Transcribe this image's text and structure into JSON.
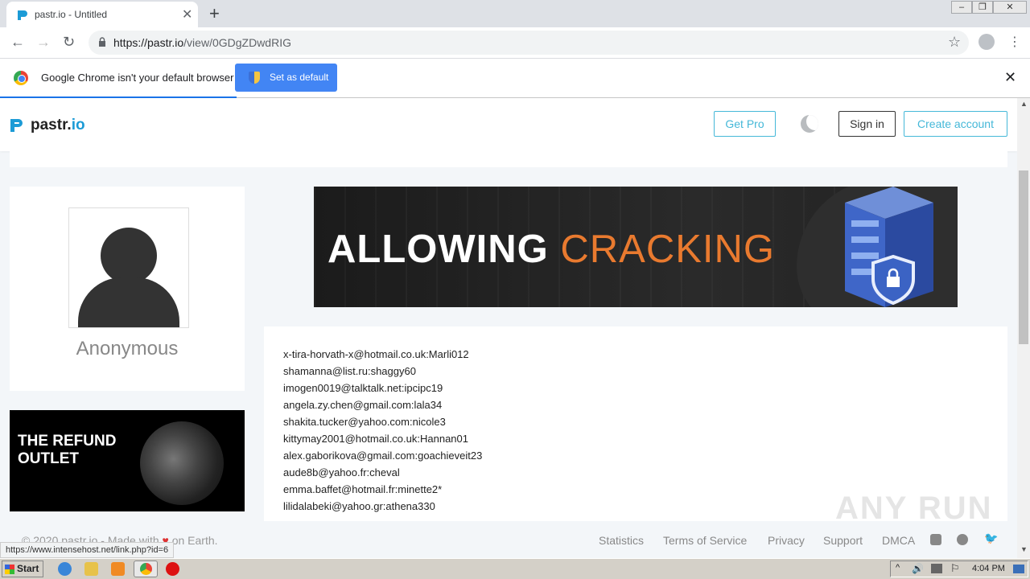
{
  "browser": {
    "tab_title": "pastr.io - Untitled",
    "url_host": "https://pastr.io",
    "url_path": "/view/0GDgZDwdRIG",
    "infobar_text": "Google Chrome isn't your default browser",
    "set_default_label": "Set as default"
  },
  "header": {
    "logo_text": "pastr.",
    "logo_suffix": "io",
    "get_pro_label": "Get Pro",
    "signin_label": "Sign in",
    "create_account_label": "Create account"
  },
  "profile": {
    "name": "Anonymous"
  },
  "ads": {
    "banner_word1": "ALLOWING",
    "banner_word2": "CRACKING",
    "refund_line1": "THE REFUND",
    "refund_line2": "OUTLET"
  },
  "paste": {
    "lines": [
      "x-tira-horvath-x@hotmail.co.uk:Marli012",
      "shamanna@list.ru:shaggy60",
      "imogen0019@talktalk.net:ipcipc19",
      "angela.zy.chen@gmail.com:lala34",
      "shakita.tucker@yahoo.com:nicole3",
      "kittymay2001@hotmail.co.uk:Hannan01",
      "alex.gaborikova@gmail.com:goachieveit23",
      "aude8b@yahoo.fr:cheval",
      "emma.baffet@hotmail.fr:minette2*",
      "lilidalabeki@yahoo.gr:athena330"
    ]
  },
  "footer": {
    "copyright_pre": "© 2020 pastr.io - Made with",
    "copyright_post": "on Earth.",
    "links": [
      "Statistics",
      "Terms of Service",
      "Privacy",
      "Support",
      "DMCA"
    ]
  },
  "status_url": "https://www.intensehost.net/link.php?id=6",
  "watermark": "ANY RUN",
  "taskbar": {
    "start_label": "Start",
    "clock": "4:04 PM"
  },
  "colors": {
    "accent": "#45b8d8",
    "brand": "#1c9bd6",
    "banner_orange": "#e97a2f",
    "chrome_blue": "#4285f4"
  }
}
